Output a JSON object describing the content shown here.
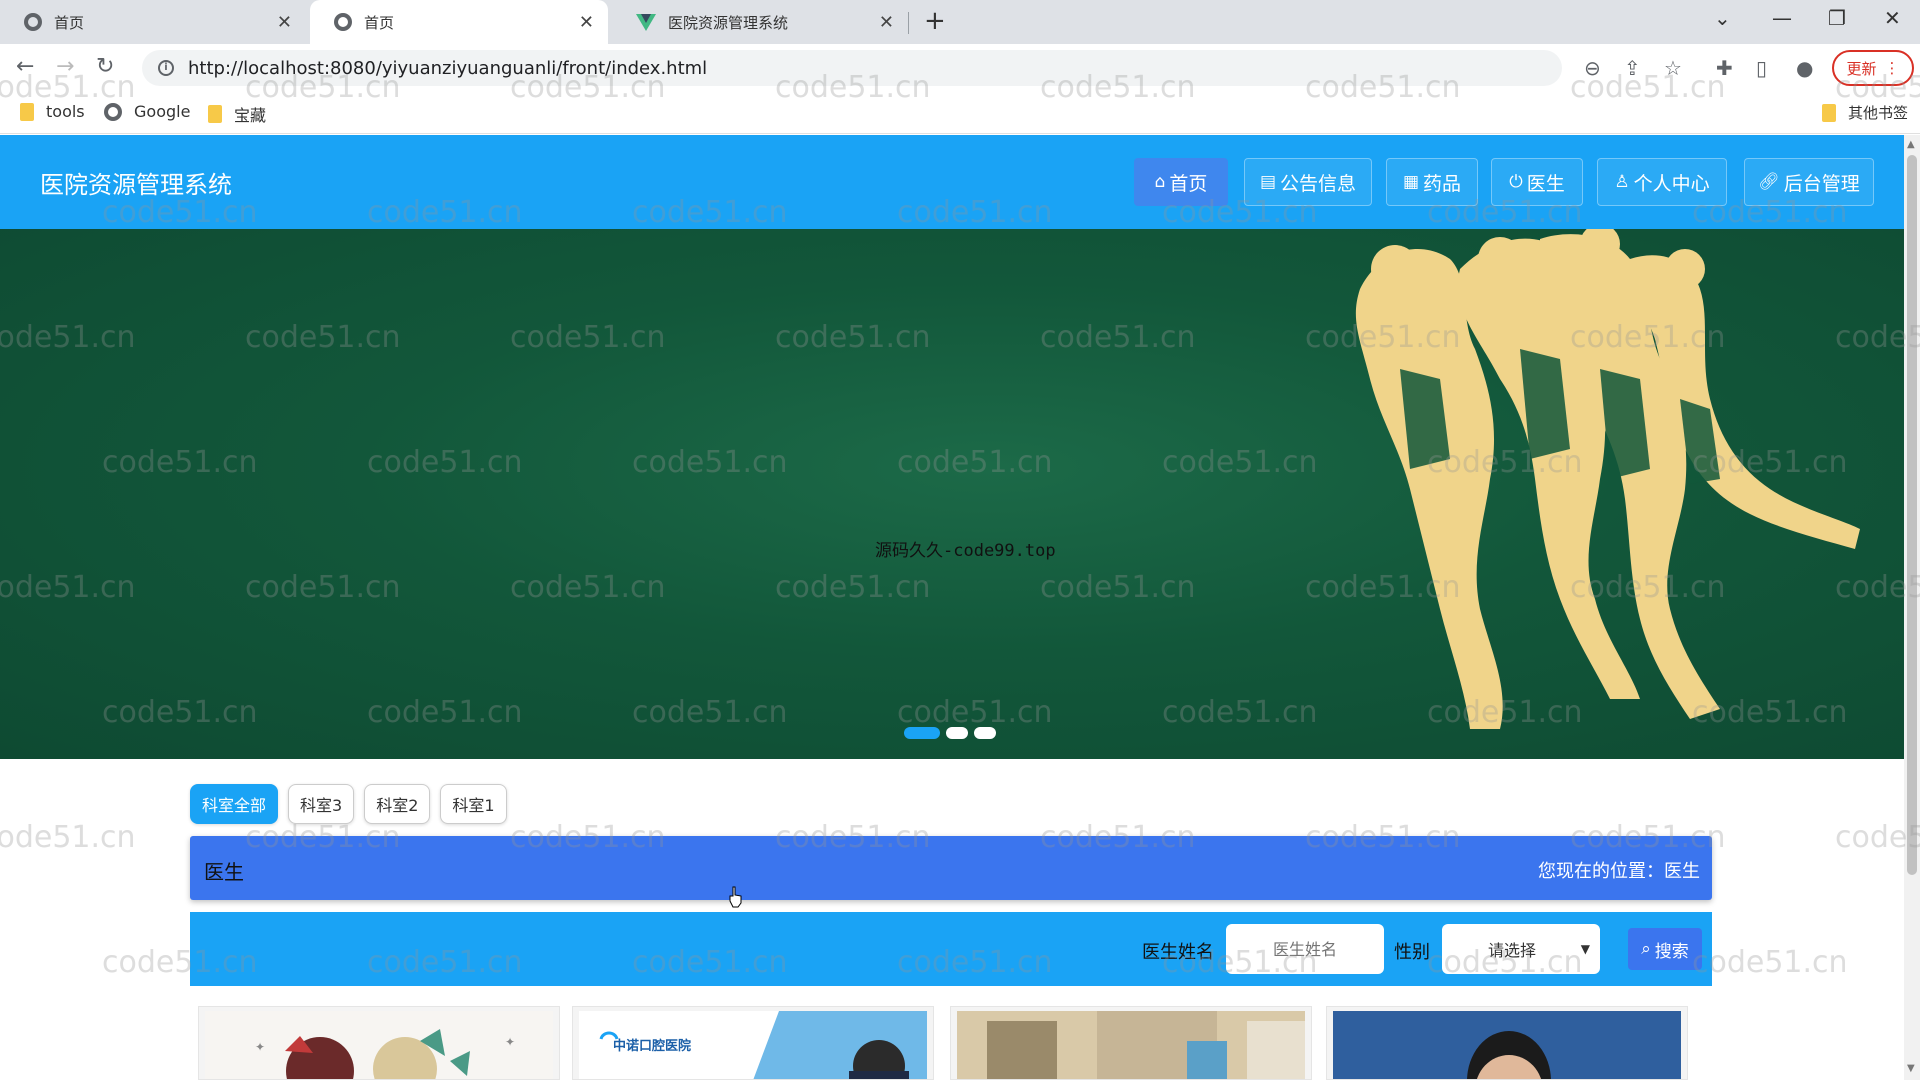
{
  "browser": {
    "tabs": [
      {
        "label": "首页",
        "icon": "globe-icon"
      },
      {
        "label": "首页",
        "icon": "globe-icon"
      },
      {
        "label": "医院资源管理系统",
        "icon": "vue-logo-icon"
      }
    ],
    "new_tab": "+",
    "url": "http://localhost:8080/yiyuanziyuanguanli/front/index.html",
    "update_label": "更新",
    "bookmarks": [
      {
        "label": "tools",
        "icon": "folder-icon"
      },
      {
        "label": "Google",
        "icon": "globe-icon"
      },
      {
        "label": "宝藏",
        "icon": "folder-icon"
      }
    ],
    "other_bookmarks": "其他书签"
  },
  "header": {
    "site_title": "医院资源管理系统",
    "nav": [
      {
        "label": "首页",
        "icon": "home-icon",
        "active": true
      },
      {
        "label": "公告信息",
        "icon": "notice-icon",
        "active": false
      },
      {
        "label": "药品",
        "icon": "medicine-icon",
        "active": false
      },
      {
        "label": "医生",
        "icon": "power-icon",
        "active": false
      },
      {
        "label": "个人中心",
        "icon": "user-icon",
        "active": false
      },
      {
        "label": "后台管理",
        "icon": "link-icon",
        "active": false
      }
    ]
  },
  "banner": {
    "caption": "源码久久-code99.top",
    "dots": 3,
    "active_dot": 0
  },
  "departments": {
    "items": [
      "科室全部",
      "科室3",
      "科室2",
      "科室1"
    ],
    "active": 0
  },
  "section": {
    "title": "医生",
    "location_prefix": "您现在的位置：",
    "location": "医生"
  },
  "search": {
    "name_label": "医生姓名",
    "name_placeholder": "医生姓名",
    "gender_label": "性别",
    "gender_value": "请选择",
    "button_label": "搜索"
  },
  "cards": [
    {
      "image": "anime-illustration"
    },
    {
      "image": "clinic-photo",
      "logo_text": "中诺口腔医院"
    },
    {
      "image": "office-photo"
    },
    {
      "image": "doctor-portrait"
    }
  ],
  "watermark": "code51.cn",
  "colors": {
    "brand": "#1aa3f5",
    "accent": "#3b75ee",
    "banner_green": "#12573a"
  }
}
